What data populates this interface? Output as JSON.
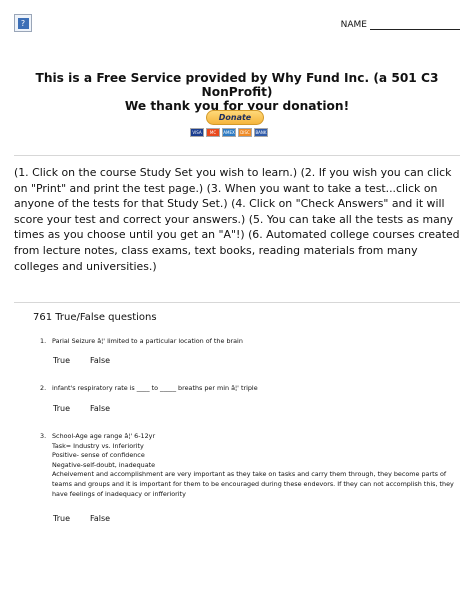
{
  "header": {
    "name_label": "NAME"
  },
  "banner": {
    "line1": "This is a Free Service provided by Why Fund Inc. (a 501 C3 NonProfit)",
    "line2": "We thank you for your donation!",
    "donate_label": "Donate",
    "cards": [
      "VISA",
      "MC",
      "AMEX",
      "DISC",
      "BANK"
    ]
  },
  "instructions": "(1. Click on the course Study Set you wish to learn.) (2. If you wish you can click on \"Print\" and print the test page.) (3. When you want to take a test...click on anyone of the tests for that Study Set.) (4. Click on \"Check Answers\" and it will score your test and correct your answers.) (5. You can take all the tests as many times as you choose until you get an \"A\"!) (6. Automated college courses created from lecture notes, class exams, text books, reading materials from many colleges and universities.)",
  "question_count": "761 True/False questions",
  "questions": [
    {
      "number": "1.",
      "lines": [
        "Parial Seizure â¦' limited to a particular location of the brain"
      ],
      "true_label": "True",
      "false_label": "False"
    },
    {
      "number": "2.",
      "lines": [
        "infant's respiratory rate is ____ to _____ breaths per min â¦' triple"
      ],
      "true_label": "True",
      "false_label": "False"
    },
    {
      "number": "3.",
      "lines": [
        "School-Age age range â¦' 6-12yr",
        "Task= Industry vs. Inferiority",
        "Positive- sense of confidence",
        "Negative-self-doubt, inadequate",
        "Acheivement and accomplishment are very important as they take on tasks and carry them through, they become parts of teams and groups and it is important for them to be encouraged during these endevors. If they can not accomplish this, they have feelings of inadequacy or infferiority"
      ],
      "true_label": "True",
      "false_label": "False"
    }
  ],
  "colors": {
    "donate_gradient_top": "#ffd97a",
    "donate_gradient_bottom": "#f5b53d",
    "donate_text": "#1e2f5e",
    "rule": "#d7d7d7"
  }
}
